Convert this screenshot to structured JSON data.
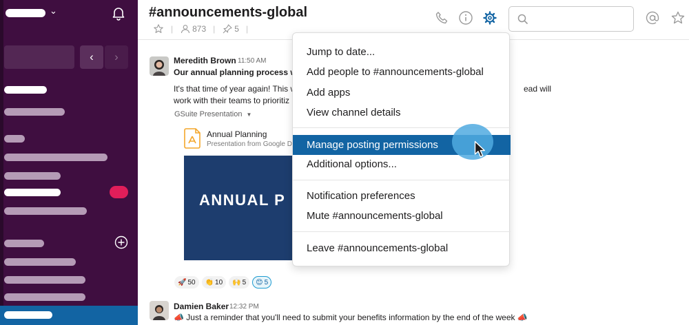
{
  "channel": {
    "title": "#announcements-global",
    "members": "873",
    "pins": "5"
  },
  "menu": {
    "items": [
      "Jump to date...",
      "Add people to #announcements-global",
      "Add apps",
      "View channel details",
      "Manage posting permissions",
      "Additional options...",
      "Notification preferences",
      "Mute #announcements-global",
      "Leave #announcements-global"
    ]
  },
  "messages": [
    {
      "name": "Meredith Brown",
      "time": "11:50 AM",
      "bold_line": "Our annual planning process will",
      "body_line1": "It's that time of year again! This w",
      "body_line1_tail": "ead will",
      "body_line2": "work with their teams to prioritiz",
      "attachment_label": "GSuite Presentation",
      "attachment_title": "Annual Planning",
      "attachment_sub": "Presentation from Google Do",
      "slide_title": "ANNUAL P",
      "reactions": [
        {
          "emoji": "🚀",
          "count": "50"
        },
        {
          "emoji": "👏",
          "count": "10"
        },
        {
          "emoji": "🙌",
          "count": "5"
        },
        {
          "emoji": "😊",
          "count": "5"
        }
      ]
    },
    {
      "name": "Damien Baker",
      "time": "12:32 PM",
      "text": "Just a reminder that you'll need to submit your benefits information by the end of the week",
      "emoji": "📣"
    }
  ],
  "colors": {
    "sidebar": "#3f0e40",
    "accent": "#1264a3",
    "badge": "#e01e5a"
  }
}
